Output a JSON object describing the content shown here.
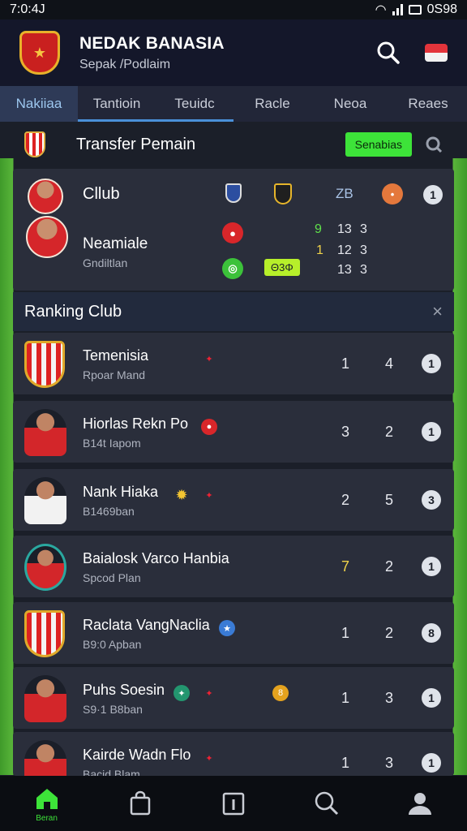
{
  "status": {
    "time": "7:0:4J",
    "right": "0S98"
  },
  "app": {
    "title": "NEDAK BANASIA",
    "subtitle": "Sepak /Podlaim"
  },
  "tabs": [
    "Nakiiaa",
    "Tantioin",
    "Teuidc",
    "Racle",
    "Neoa",
    "Reaes"
  ],
  "transfer": {
    "title": "Transfer Pemain",
    "button": "Senabias"
  },
  "transfer_card": {
    "club_label": "Cllub",
    "player_name": "Neamiale",
    "player_sub": "Gndiltlan",
    "score_label": "ZB",
    "nums": [
      "9",
      "13",
      "3",
      "1",
      "12",
      "3",
      "13",
      "3"
    ],
    "tag": "Θ3Φ"
  },
  "ranking": {
    "title": "Ranking Club",
    "close": "×"
  },
  "rows": [
    {
      "name": "Temenisia",
      "sub": "Rpoar Mand",
      "c1": "1",
      "c2": "4",
      "info": "1"
    },
    {
      "name": "Hiorlas Rekn Po",
      "sub": "B14t Iapom",
      "c1": "3",
      "c2": "2",
      "info": "1"
    },
    {
      "name": "Nank Hiaka",
      "sub": "B1469ban",
      "c1": "2",
      "c2": "5",
      "info": "3"
    },
    {
      "name": "Baialosk Varco Hanbia",
      "sub": "Spcod Plan",
      "c1": "7",
      "c2": "2",
      "info": "1"
    },
    {
      "name": "Raclata VangNaclia",
      "sub": "B9:0 Apban",
      "c1": "1",
      "c2": "2",
      "info": "8"
    },
    {
      "name": "Puhs Soesin",
      "sub": "S9·1 B8ban",
      "c1": "1",
      "c2": "3",
      "info": "1"
    },
    {
      "name": "Kairde Wadn Flo",
      "sub": "Bacid Blam",
      "c1": "1",
      "c2": "3",
      "info": "1"
    }
  ],
  "nav": {
    "home_label": "Beran"
  },
  "colors": {
    "accent": "#3de339",
    "tab_active": "#2e3a57",
    "brand_red": "#d5262a"
  }
}
